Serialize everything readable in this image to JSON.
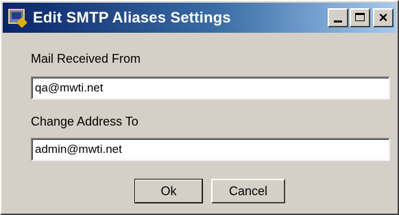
{
  "window": {
    "title": "Edit SMTP Aliases Settings",
    "icon": "app-window-icon",
    "controls": {
      "minimize_icon": "minimize-icon",
      "maximize_icon": "maximize-icon",
      "close_glyph": "×"
    }
  },
  "form": {
    "from_label": "Mail Received From",
    "from_value": "qa@mwti.net",
    "to_label": "Change Address To",
    "to_value": "admin@mwti.net"
  },
  "buttons": {
    "ok_label": "Ok",
    "cancel_label": "Cancel"
  },
  "colors": {
    "titlebar_start": "#0a246a",
    "titlebar_end": "#a6caf0",
    "face": "#d4d0c8"
  }
}
